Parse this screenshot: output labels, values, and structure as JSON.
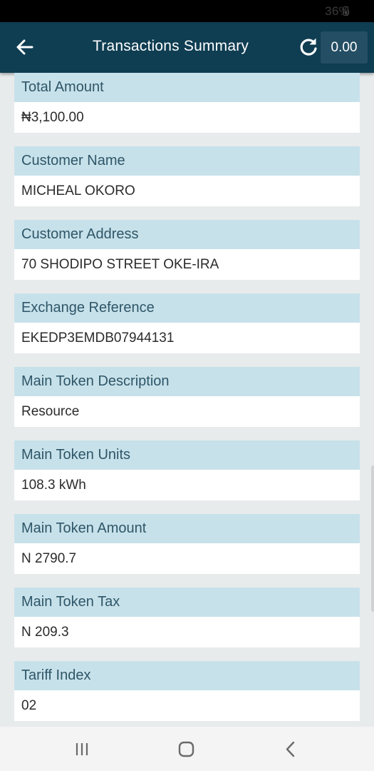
{
  "status_bar": {
    "battery_text": "36%"
  },
  "header": {
    "title": "Transactions Summary",
    "balance": "0.00"
  },
  "fields": [
    {
      "label": "Total Amount",
      "value": "₦3,100.00"
    },
    {
      "label": "Customer Name",
      "value": "MICHEAL OKORO"
    },
    {
      "label": "Customer Address",
      "value": "70 SHODIPO STREET OKE-IRA"
    },
    {
      "label": "Exchange Reference",
      "value": "EKEDP3EMDB07944131"
    },
    {
      "label": "Main Token Description",
      "value": "Resource"
    },
    {
      "label": "Main Token Units",
      "value": "108.3 kWh"
    },
    {
      "label": "Main Token Amount",
      "value": "N 2790.7"
    },
    {
      "label": "Main Token Tax",
      "value": "N 209.3"
    },
    {
      "label": "Tariff Index",
      "value": "02"
    }
  ],
  "colors": {
    "app_bar": "#0f3d52",
    "card_header": "#c7e1ea",
    "card_header_text": "#2e5668",
    "page_background": "#e8ebec"
  },
  "icons": {
    "back": "arrow-left-icon",
    "refresh": "refresh-icon",
    "nav_recents": "recents-icon",
    "nav_home": "home-icon",
    "nav_back": "chevron-left-icon"
  }
}
